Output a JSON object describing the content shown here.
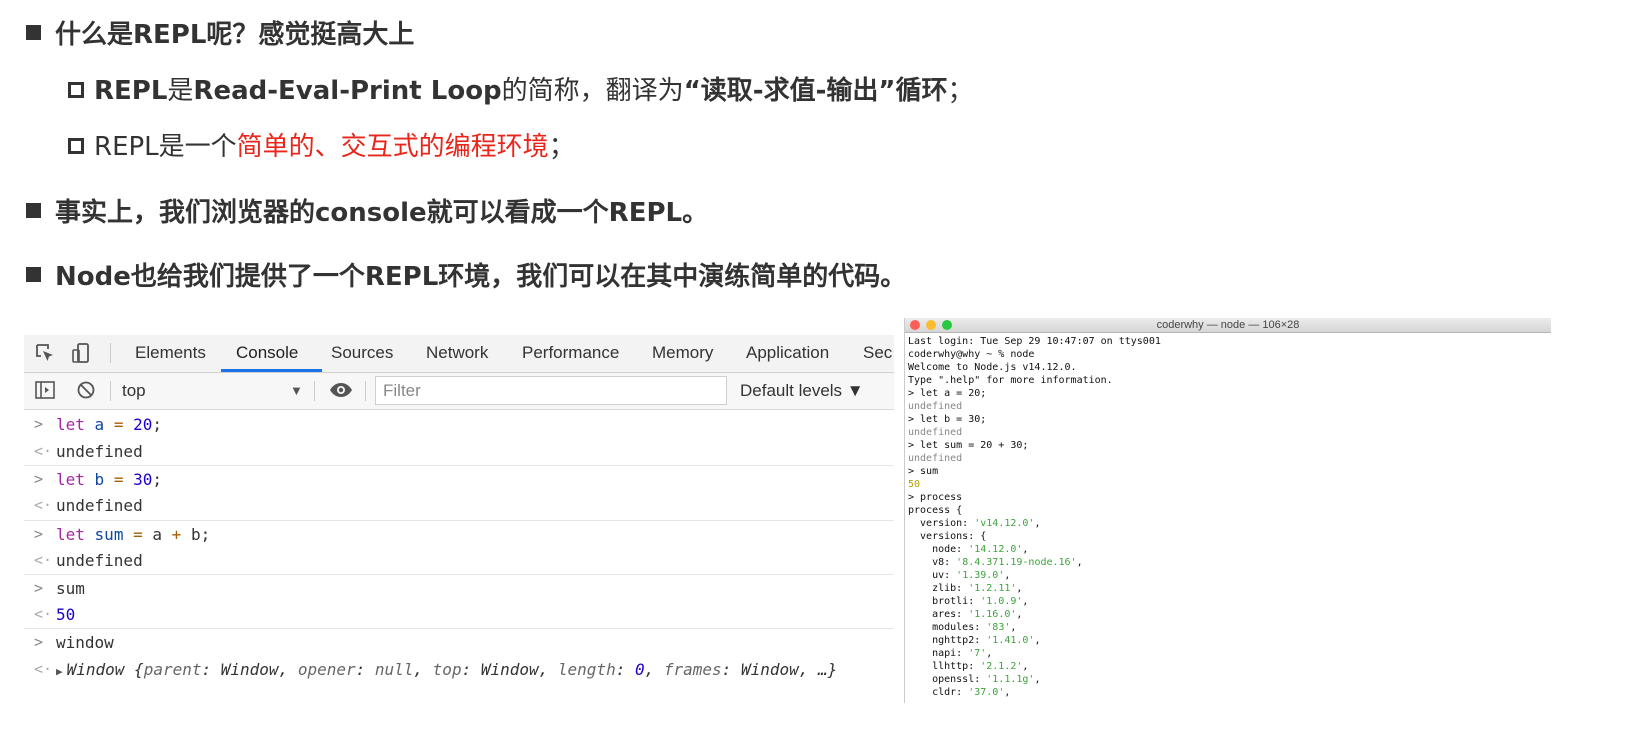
{
  "slide": {
    "b1": "什么是REPL呢？感觉挺高大上",
    "s1": {
      "p1": "REPL",
      "p2": "是",
      "p3": "Read-Eval-Print Loop",
      "p4": "的简称，翻译为",
      "p5": "“读取-求值-输出”循环",
      "p6": "；"
    },
    "s2": {
      "p1": "REPL是一个",
      "p2": "简单的、交互式的编程环境",
      "p3": "；"
    },
    "b2": "事实上，我们浏览器的console就可以看成一个REPL。",
    "b3": "Node也给我们提供了一个REPL环境，我们可以在其中演练简单的代码。",
    "colors": {
      "text": "#333333",
      "highlight": "#e8261c"
    }
  },
  "devtools": {
    "tabs": [
      "Elements",
      "Console",
      "Sources",
      "Network",
      "Performance",
      "Memory",
      "Application",
      "Sec"
    ],
    "active_tab": "Console",
    "context": "top",
    "filter_placeholder": "Filter",
    "levels": "Default levels ▼",
    "icons": [
      "inspect-icon",
      "device-toggle-icon",
      "sidebar-toggle-icon",
      "clear-console-icon",
      "eye-icon"
    ],
    "console": {
      "l1": {
        "kw": "let",
        "v": "a",
        "op": "=",
        "n": "20",
        "end": ";"
      },
      "r1": "undefined",
      "l2": {
        "kw": "let",
        "v": "b",
        "op": "=",
        "n": "30",
        "end": ";"
      },
      "r2": "undefined",
      "l3": {
        "kw": "let",
        "v": "sum",
        "op": "=",
        "a": "a",
        "plus": "+",
        "b": "b",
        "end": ";"
      },
      "r3": "undefined",
      "l4": "sum",
      "r4": "50",
      "l5": "window",
      "r5": {
        "pre": "Window {",
        "k1": "parent",
        "v1": "Window",
        "k2": "opener",
        "v2": "null",
        "k3": "top",
        "v3": "Window",
        "k4": "length",
        "v4": "0",
        "k5": "frames",
        "v5": "Window",
        "end": "…}"
      }
    }
  },
  "terminal": {
    "title": "coderwhy — node — 106×28",
    "lines": [
      "Last login: Tue Sep 29 10:47:07 on ttys001",
      "coderwhy@why ~ % node",
      "Welcome to Node.js v14.12.0.",
      "Type \".help\" for more information.",
      "> let a = 20;",
      "undefined",
      "> let b = 30;",
      "undefined",
      "> let sum = 20 + 30;",
      "undefined",
      "> sum",
      "50",
      "> process",
      "process {"
    ],
    "entries": [
      {
        "k": "  version: ",
        "v": "'v14.12.0'"
      },
      {
        "k": "  versions: {",
        "v": ""
      },
      {
        "k": "    node: ",
        "v": "'14.12.0'"
      },
      {
        "k": "    v8: ",
        "v": "'8.4.371.19-node.16'"
      },
      {
        "k": "    uv: ",
        "v": "'1.39.0'"
      },
      {
        "k": "    zlib: ",
        "v": "'1.2.11'"
      },
      {
        "k": "    brotli: ",
        "v": "'1.0.9'"
      },
      {
        "k": "    ares: ",
        "v": "'1.16.0'"
      },
      {
        "k": "    modules: ",
        "v": "'83'"
      },
      {
        "k": "    nghttp2: ",
        "v": "'1.41.0'"
      },
      {
        "k": "    napi: ",
        "v": "'7'"
      },
      {
        "k": "    llhttp: ",
        "v": "'2.1.2'"
      },
      {
        "k": "    openssl: ",
        "v": "'1.1.1g'"
      },
      {
        "k": "    cldr: ",
        "v": "'37.0'"
      }
    ]
  }
}
